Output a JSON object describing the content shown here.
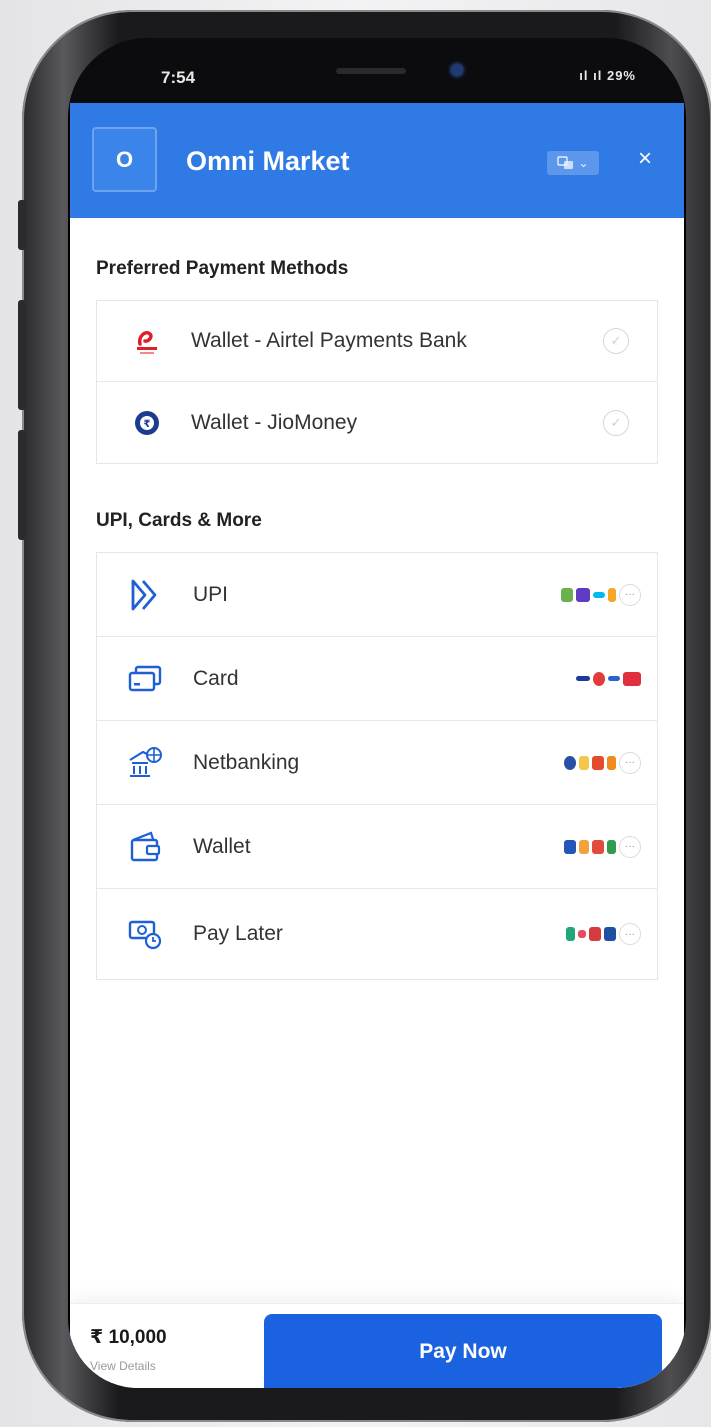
{
  "status_bar": {
    "time": "7:54",
    "signal": "ıl ıl 29%"
  },
  "header": {
    "logo_letter": "O",
    "merchant_name": "Omni Market",
    "language_icon": "translate-icon",
    "chevron": "⌄",
    "close_label": "×",
    "color": "#2f7ae5"
  },
  "preferred": {
    "title": "Preferred Payment Methods",
    "items": [
      {
        "label": "Wallet - Airtel Payments Bank",
        "icon": "airtel-logo-icon"
      },
      {
        "label": "Wallet - JioMoney",
        "icon": "jiomoney-logo-icon"
      }
    ]
  },
  "methods": {
    "title": "UPI, Cards & More",
    "items": [
      {
        "label": "UPI",
        "icon": "upi-icon"
      },
      {
        "label": "Card",
        "icon": "card-icon"
      },
      {
        "label": "Netbanking",
        "icon": "bank-icon"
      },
      {
        "label": "Wallet",
        "icon": "wallet-icon"
      },
      {
        "label": "Pay Later",
        "icon": "pay-later-icon"
      }
    ],
    "more_label": "···"
  },
  "footer": {
    "amount": "₹ 10,000",
    "view_details": "View Details",
    "pay_label": "Pay Now",
    "pay_color": "#1b62e0"
  }
}
